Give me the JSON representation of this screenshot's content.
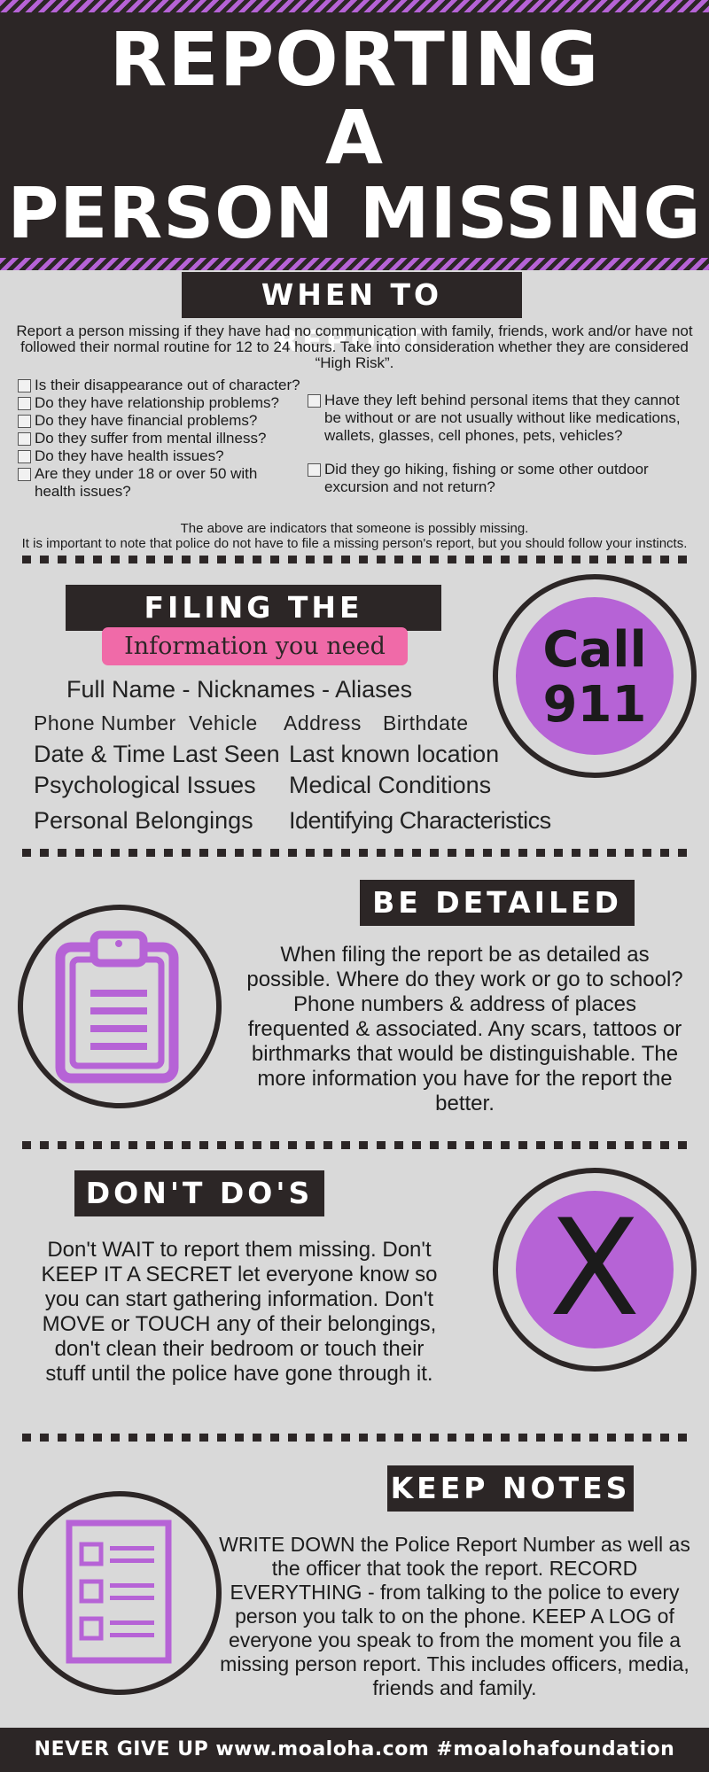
{
  "header": {
    "line1": "REPORTING",
    "line2": "A",
    "line3": "PERSON MISSING"
  },
  "when": {
    "label": "WHEN TO REPORT",
    "intro": "Report a person missing if they have had no communication with family, friends, work and/or have not followed their normal routine for 12 to 24 hours. Take into consideration whether they are considered “High Risk”.",
    "left_items": [
      "Is their disappearance out of character?",
      "Do they have relationship problems?",
      "Do they have financial problems?",
      "Do they suffer from mental illness?",
      "Do they have health issues?",
      "Are they under 18 or over 50 with health issues?"
    ],
    "right_items": [
      "Have they left behind personal items that they cannot be without or are not usually without like medications, wallets, glasses, cell phones, pets, vehicles?",
      "Did they go hiking, fishing or some other outdoor excursion and not return?"
    ],
    "note1": "The above are indicators that someone is possibly missing.",
    "note2": "It is important to note that police do not have to file a missing person's report, but you should follow your instincts."
  },
  "filing": {
    "label": "FILING THE REPORT",
    "sub_label": "Information you need",
    "full_name": "Full Name - Nicknames - Aliases",
    "phone": "Phone Number",
    "vehicle": "Vehicle",
    "address": "Address",
    "birthdate": "Birthdate",
    "date_time": "Date & Time Last Seen",
    "last_location": "Last known location",
    "psych": "Psychological Issues",
    "medical": "Medical Conditions",
    "belongings": "Personal Belongings",
    "identifying": "Identifying Characteristics",
    "call_line1": "Call",
    "call_line2": "911"
  },
  "detailed": {
    "label": "BE DETAILED",
    "text": "When filing the report be as detailed as possible.  Where do they work or go to school? Phone numbers & address of places frequented & associated. Any scars, tattoos or birthmarks that would be distinguishable. The more information you have for the report the better.",
    "icon": "clipboard-icon"
  },
  "donts": {
    "label": "DON'T DO'S",
    "text": "Don't WAIT to report them missing. Don't KEEP IT A SECRET let everyone know so you can start gathering information. Don't MOVE or TOUCH any of their belongings, don't clean their bedroom or touch their stuff until the police have gone through it.",
    "mark": "X"
  },
  "notes": {
    "label": "KEEP NOTES",
    "text": "WRITE DOWN the Police Report Number as well as the officer that took the report. RECORD EVERYTHING - from talking to the police to every person you talk to on the phone. KEEP A LOG of everyone you speak to from the moment you file a missing person report. This includes officers, media, friends and family.",
    "icon": "checklist-icon"
  },
  "footer": {
    "text": "NEVER GIVE UP www.moaloha.com #moalohafoundation"
  },
  "colors": {
    "dark": "#2c2626",
    "purple": "#b663d6",
    "pink": "#f06aa8",
    "background": "#d9d9d9"
  }
}
